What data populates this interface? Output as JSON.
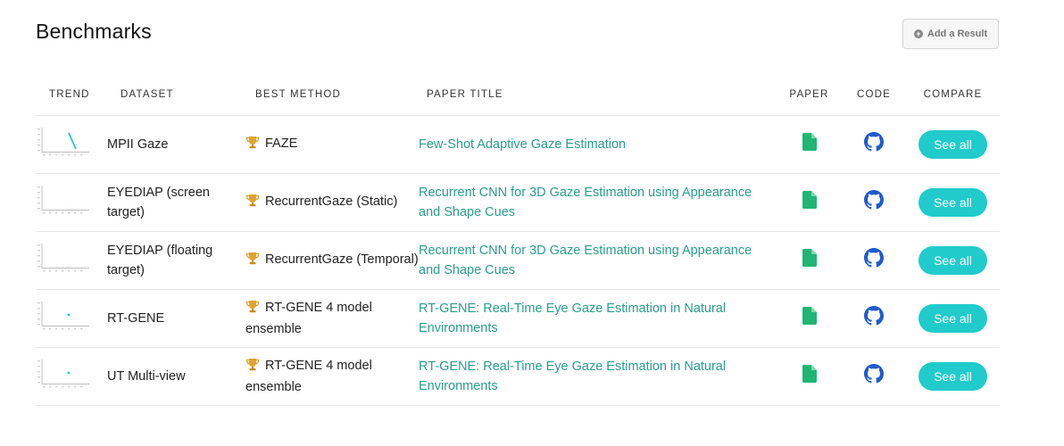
{
  "header": {
    "title": "Benchmarks",
    "add_result_label": "Add a Result"
  },
  "columns": {
    "trend": "TREND",
    "dataset": "DATASET",
    "best_method": "BEST METHOD",
    "paper_title": "PAPER TITLE",
    "paper": "PAPER",
    "code": "CODE",
    "compare": "COMPARE"
  },
  "rows": [
    {
      "dataset": "MPII Gaze",
      "best_method": "FAZE",
      "paper_title": "Few-Shot Adaptive Gaze Estimation",
      "compare_label": "See all",
      "trend_icon": "trend-line-icon"
    },
    {
      "dataset": "EYEDIAP (screen target)",
      "best_method": "RecurrentGaze (Static)",
      "paper_title": "Recurrent CNN for 3D Gaze Estimation using Appearance and Shape Cues",
      "compare_label": "See all",
      "trend_icon": "trend-line-icon"
    },
    {
      "dataset": "EYEDIAP (floating target)",
      "best_method": "RecurrentGaze (Temporal)",
      "paper_title": "Recurrent CNN for 3D Gaze Estimation using Appearance and Shape Cues",
      "compare_label": "See all",
      "trend_icon": "trend-line-icon"
    },
    {
      "dataset": "RT-GENE",
      "best_method": "RT-GENE 4 model ensemble",
      "paper_title": "RT-GENE: Real-Time Eye Gaze Estimation in Natural Environments",
      "compare_label": "See all",
      "trend_icon": "trend-dot-icon"
    },
    {
      "dataset": "UT Multi-view",
      "best_method": "RT-GENE 4 model ensemble",
      "paper_title": "RT-GENE: Real-Time Eye Gaze Estimation in Natural Environments",
      "compare_label": "See all",
      "trend_icon": "trend-dot-icon"
    }
  ],
  "icons": {
    "paper": "pdf-file-icon",
    "code": "github-icon",
    "method": "trophy-icon",
    "add": "plus-circle-icon"
  },
  "colors": {
    "link": "#2a9d8f",
    "see_all_bg": "#21cbcb",
    "pdf_icon": "#21b573",
    "github_icon": "#1f5bcc",
    "trophy": "#e0a32e"
  }
}
